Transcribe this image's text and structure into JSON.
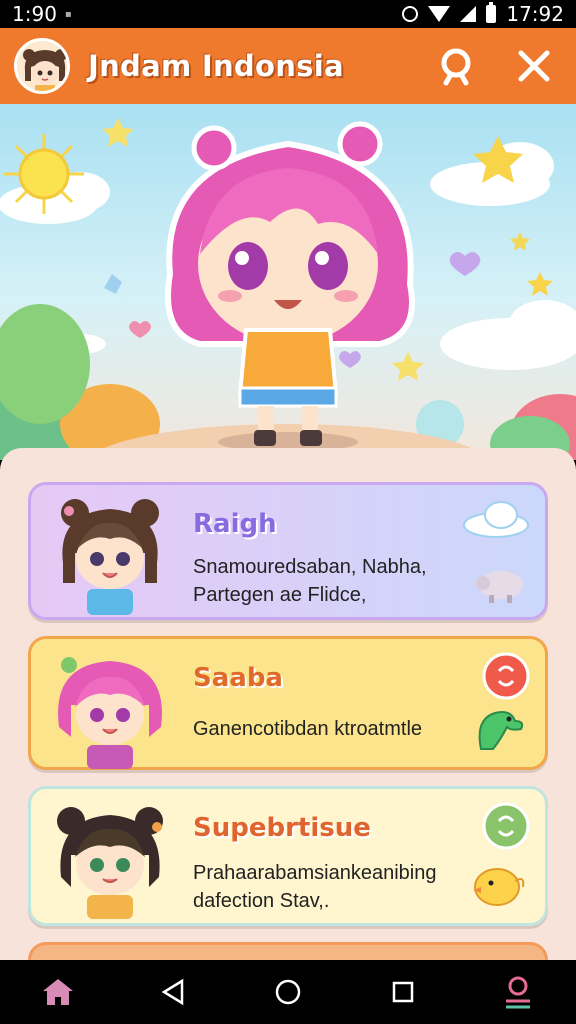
{
  "status": {
    "left_time": "1:90",
    "right_time": "17:92"
  },
  "header": {
    "title": "Jndam Indonsia",
    "avatar_icon": "avatar-girl-icon",
    "search_icon": "search-icon",
    "close_icon": "close-icon",
    "accent": "#ef7a2d"
  },
  "hero": {
    "illustration": "pink-hair-chibi-girl"
  },
  "cards": [
    {
      "name": "Raigh",
      "description": "Snamouredsaban, Nabha, Partegen ae Flidce,",
      "icon_top": "cloud-icon",
      "icon_bottom": "sheep-icon"
    },
    {
      "name": "Saaba",
      "description": "Ganencotibdan ktroatmtle",
      "icon_top": "red-badge-icon",
      "icon_bottom": "dinosaur-icon"
    },
    {
      "name": "Supebrtisue",
      "description": "Prahaarabamsiankeanibing dafection Stav,.",
      "icon_top": "green-badge-icon",
      "icon_bottom": "chick-icon"
    }
  ],
  "nav": {
    "home_icon": "home-icon",
    "back_icon": "back-icon",
    "home_circle_icon": "circle-home-icon",
    "recents_icon": "recents-icon",
    "profile_icon": "profile-icon"
  }
}
